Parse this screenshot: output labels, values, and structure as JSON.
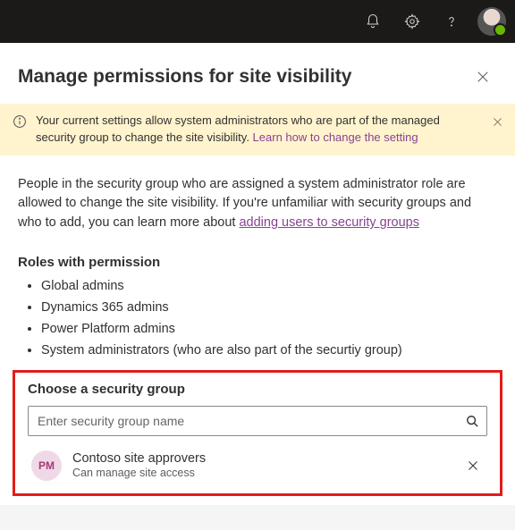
{
  "panel": {
    "title": "Manage permissions for site visibility"
  },
  "infoBar": {
    "text": "Your current settings allow system administrators who are part of the managed security group to change the site visibility. ",
    "linkText": "Learn how to change the setting"
  },
  "body": {
    "text": "People in the security group who are assigned a system administrator role are allowed to change the site visibility. If you're unfamiliar with security groups and who to add, you can learn more about ",
    "linkText": "adding users to security groups"
  },
  "rolesHeading": "Roles with permission",
  "roles": [
    "Global admins",
    "Dynamics 365 admins",
    "Power Platform admins",
    "System administrators (who are also part of the securtiy group)"
  ],
  "chooseHeading": "Choose a security group",
  "search": {
    "placeholder": "Enter security group name"
  },
  "selectedGroup": {
    "initials": "PM",
    "name": "Contoso site approvers",
    "desc": "Can manage site access"
  }
}
